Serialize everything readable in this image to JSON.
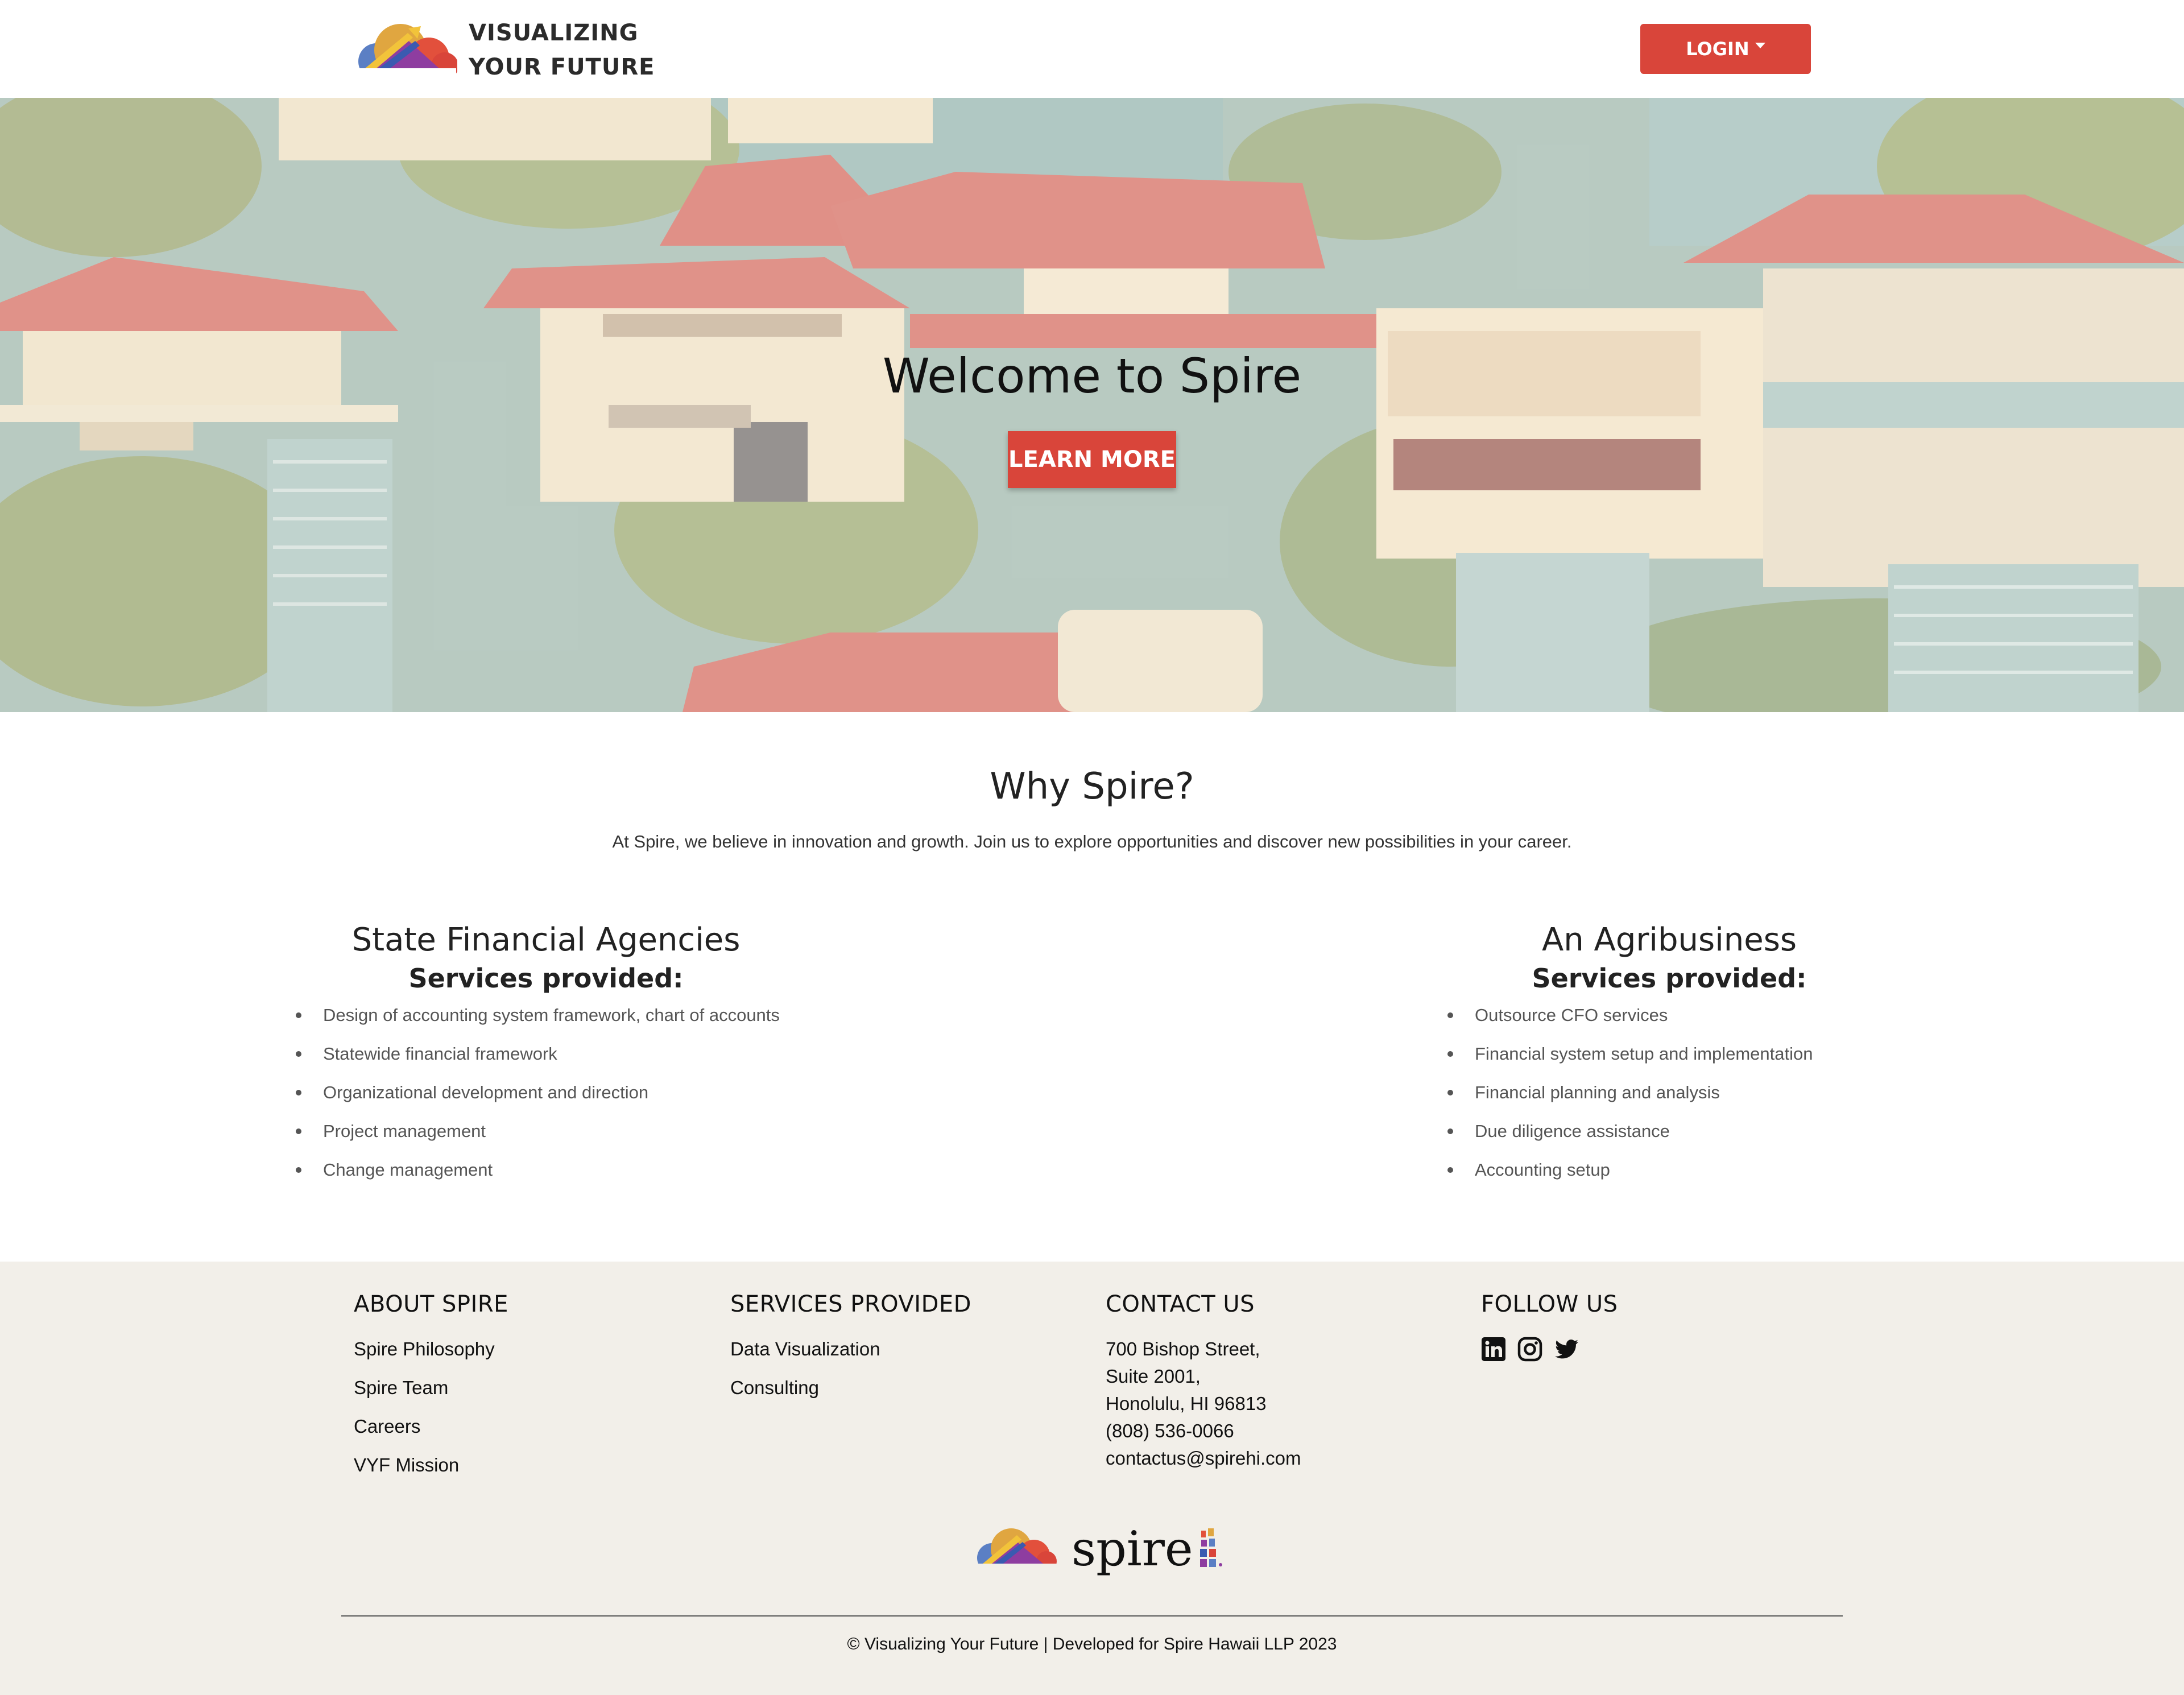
{
  "navbar": {
    "brand_line1": "VISUALIZING",
    "brand_line2": "YOUR FUTURE",
    "login_label": "LOGIN"
  },
  "hero": {
    "title": "Welcome to Spire",
    "cta_label": "LEARN MORE"
  },
  "why": {
    "title": "Why Spire?",
    "text": "At Spire, we believe in innovation and growth. Join us to explore opportunities and discover new possibilities in your career."
  },
  "services_left": {
    "title": "State Financial Agencies",
    "subtitle": "Services provided:",
    "items": [
      "Design of accounting system framework, chart of accounts",
      "Statewide financial framework",
      "Organizational development and direction",
      "Project management",
      "Change management"
    ]
  },
  "services_right": {
    "title": "An Agribusiness",
    "subtitle": "Services provided:",
    "items": [
      "Outsource CFO services",
      "Financial system setup and implementation",
      "Financial planning and analysis",
      "Due diligence assistance",
      "Accounting setup"
    ]
  },
  "footer": {
    "about": {
      "heading": "ABOUT SPIRE",
      "links": [
        "Spire Philosophy",
        "Spire Team",
        "Careers",
        "VYF Mission"
      ]
    },
    "services": {
      "heading": "SERVICES PROVIDED",
      "links": [
        "Data Visualization",
        "Consulting"
      ]
    },
    "contact": {
      "heading": "CONTACT US",
      "lines": [
        "700 Bishop Street,",
        "Suite 2001,",
        "Honolulu, HI 96813",
        "(808) 536-0066",
        "contactus@spirehi.com"
      ]
    },
    "follow": {
      "heading": "FOLLOW US",
      "icons": [
        "linkedin-icon",
        "instagram-icon",
        "twitter-icon"
      ]
    },
    "logo_word": "spire",
    "copyright": "© Visualizing Your Future | Developed for Spire Hawaii LLP 2023"
  },
  "colors": {
    "accent": "#d9453a",
    "footer_bg": "#f2efe9"
  }
}
